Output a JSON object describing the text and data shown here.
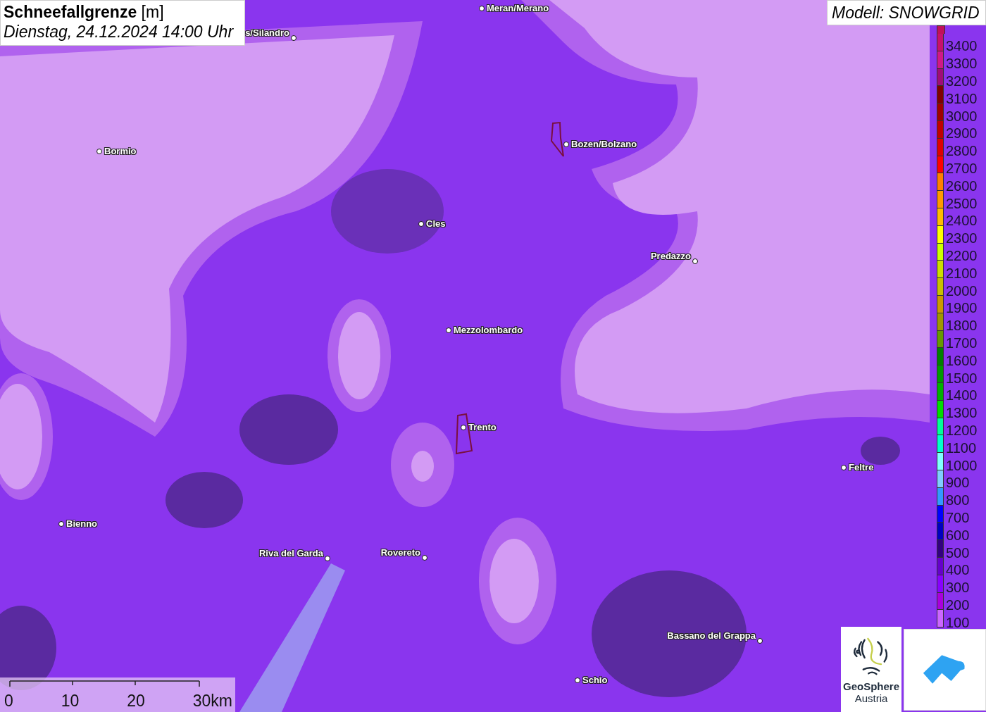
{
  "title": {
    "heading": "**Schneefallgrenze** [m]",
    "datetime": "Dienstag, 24.12.2024 14:00 Uhr"
  },
  "model": "Modell: SNOWGRID",
  "cities": [
    {
      "name": "Meran/Merano"
    },
    {
      "name": "s/Silandro"
    },
    {
      "name": "Bormio"
    },
    {
      "name": "Bozen/Bolzano"
    },
    {
      "name": "Cles"
    },
    {
      "name": "Predazzo"
    },
    {
      "name": "Mezzolombardo"
    },
    {
      "name": "Trento"
    },
    {
      "name": "Feltre"
    },
    {
      "name": "Bienno"
    },
    {
      "name": "Riva del Garda"
    },
    {
      "name": "Rovereto"
    },
    {
      "name": "Bassano del Grappa"
    },
    {
      "name": "Schio"
    }
  ],
  "legend": [
    {
      "label": "3400",
      "color": "#c8106c"
    },
    {
      "label": "3300",
      "color": "#d01888"
    },
    {
      "label": "3200",
      "color": "#a00c78"
    },
    {
      "label": "3100",
      "color": "#800000"
    },
    {
      "label": "3000",
      "color": "#a00000"
    },
    {
      "label": "2900",
      "color": "#c00000"
    },
    {
      "label": "2800",
      "color": "#e00000"
    },
    {
      "label": "2700",
      "color": "#ff0000"
    },
    {
      "label": "2600",
      "color": "#ff8000"
    },
    {
      "label": "2500",
      "color": "#ff9900"
    },
    {
      "label": "2400",
      "color": "#ffbb00"
    },
    {
      "label": "2300",
      "color": "#ffff00"
    },
    {
      "label": "2200",
      "color": "#ccff00"
    },
    {
      "label": "2100",
      "color": "#ccdd00"
    },
    {
      "label": "2000",
      "color": "#c8c000"
    },
    {
      "label": "1900",
      "color": "#cc9900"
    },
    {
      "label": "1800",
      "color": "#a09600"
    },
    {
      "label": "1700",
      "color": "#669900"
    },
    {
      "label": "1600",
      "color": "#008000"
    },
    {
      "label": "1500",
      "color": "#009900"
    },
    {
      "label": "1400",
      "color": "#00b000"
    },
    {
      "label": "1300",
      "color": "#00dd00"
    },
    {
      "label": "1200",
      "color": "#00ff99"
    },
    {
      "label": "1100",
      "color": "#00ffcc"
    },
    {
      "label": "1000",
      "color": "#80ffff"
    },
    {
      "label": "900",
      "color": "#80ccff"
    },
    {
      "label": "800",
      "color": "#3399ff"
    },
    {
      "label": "700",
      "color": "#0000ff"
    },
    {
      "label": "600",
      "color": "#0000c0"
    },
    {
      "label": "500",
      "color": "#330080"
    },
    {
      "label": "400",
      "color": "#6600cc"
    },
    {
      "label": "300",
      "color": "#8800ff"
    },
    {
      "label": "200",
      "color": "#aa00dd"
    },
    {
      "label": "100",
      "color": "#cc66ff"
    }
  ],
  "scale_bar": {
    "ticks": [
      "0",
      "10",
      "20",
      "30km"
    ]
  },
  "logos": {
    "geosphere": {
      "line1": "GeoSphere",
      "line2": "Austria"
    }
  }
}
